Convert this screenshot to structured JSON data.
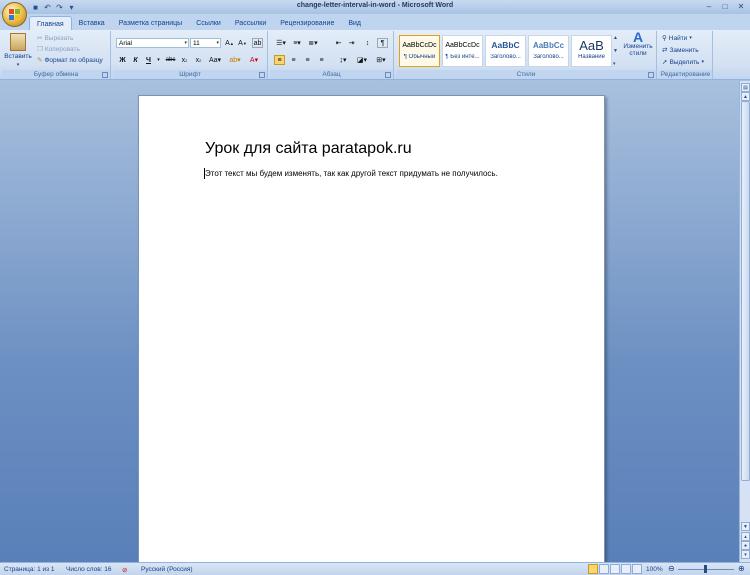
{
  "window": {
    "title": "change-letter-interval-in-word - Microsoft Word",
    "buttons": [
      "–",
      "□",
      "✕"
    ]
  },
  "tabs": [
    "Главная",
    "Вставка",
    "Разметка страницы",
    "Ссылки",
    "Рассылки",
    "Рецензирование",
    "Вид"
  ],
  "active_tab": "Главная",
  "clipboard": {
    "paste": "Вставить",
    "cut": "Вырезать",
    "copy": "Копировать",
    "format_painter": "Формат по образцу",
    "label": "Буфер обмена"
  },
  "font": {
    "name": "Arial",
    "size": "11",
    "label": "Шрифт"
  },
  "paragraph": {
    "label": "Абзац"
  },
  "styles": {
    "items": [
      {
        "preview": "AaBbCcDc",
        "name": "¶ Обычный"
      },
      {
        "preview": "AaBbCcDc",
        "name": "¶ Без инте..."
      },
      {
        "preview": "AaBbC",
        "name": "Заголово..."
      },
      {
        "preview": "AaBbCc",
        "name": "Заголово..."
      },
      {
        "preview": "AaB",
        "name": "Название"
      }
    ],
    "change_styles": "Изменить стили",
    "label": "Стили"
  },
  "editing": {
    "find": "Найти",
    "replace": "Заменить",
    "select": "Выделить",
    "label": "Редактирование"
  },
  "document": {
    "heading": "Урок для сайта paratapok.ru",
    "body": "Этот текст мы будем изменять, так как другой текст придумать не получилось."
  },
  "status": {
    "page": "Страница: 1 из 1",
    "words": "Число слов: 16",
    "language": "Русский (Россия)",
    "zoom": "100%"
  }
}
